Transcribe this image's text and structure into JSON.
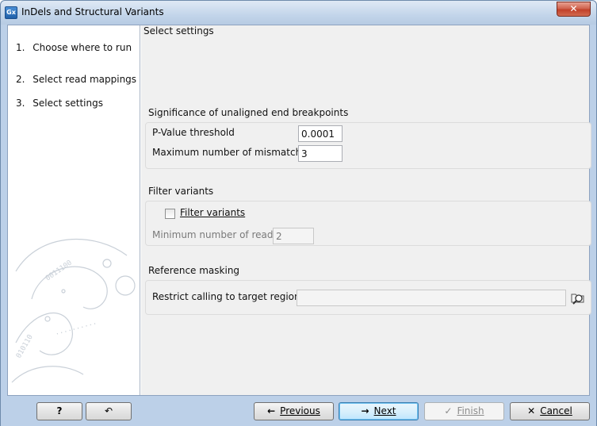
{
  "window": {
    "title": "InDels and Structural Variants",
    "icon_text": "Gx",
    "close_glyph": "✕"
  },
  "steps": [
    {
      "number": "1.",
      "label": "Choose where to run"
    },
    {
      "number": "2.",
      "label": "Select read mappings"
    },
    {
      "number": "3.",
      "label": "Select settings"
    }
  ],
  "main": {
    "section_title": "Select settings",
    "unaligned": {
      "title": "Significance of unaligned end breakpoints",
      "pvalue_label": "P-Value threshold",
      "pvalue_value": "0.0001",
      "mismatch_label": "Maximum number of mismatches",
      "mismatch_value": "3"
    },
    "filter": {
      "title": "Filter variants",
      "checkbox_label": "Filter variants",
      "checked": false,
      "min_reads_label": "Minimum number of reads",
      "min_reads_value": "2"
    },
    "masking": {
      "title": "Reference masking",
      "restrict_label": "Restrict calling to target regions",
      "restrict_value": ""
    }
  },
  "buttons": {
    "help": "?",
    "reset_icon": "↶",
    "previous_icon": "←",
    "previous": "Previous",
    "next_icon": "→",
    "next": "Next",
    "finish_icon": "✓",
    "finish": "Finish",
    "cancel_icon": "✕",
    "cancel": "Cancel"
  }
}
